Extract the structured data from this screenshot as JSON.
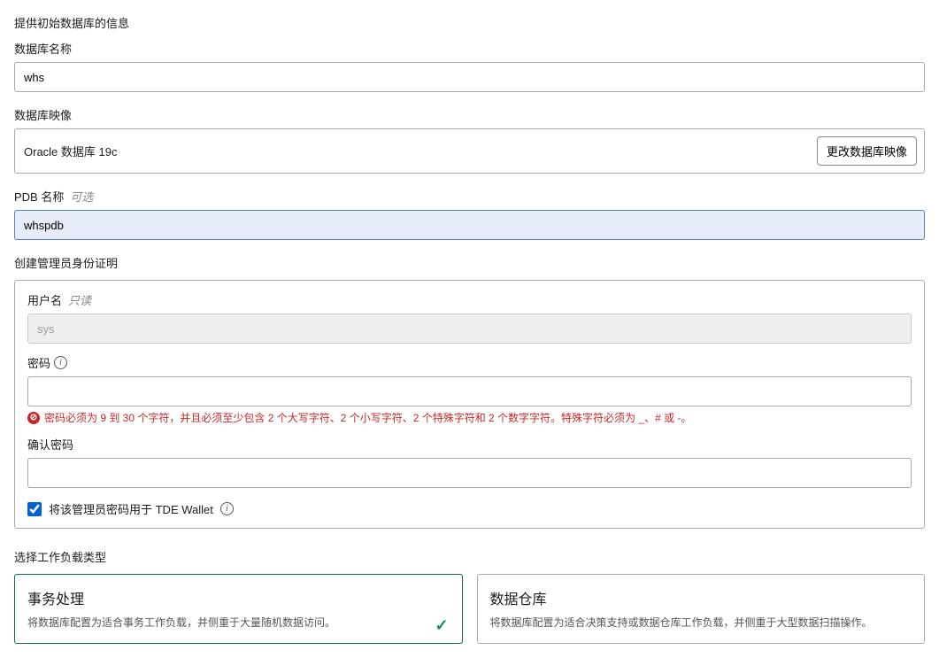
{
  "header": {
    "title": "提供初始数据库的信息"
  },
  "dbName": {
    "label": "数据库名称",
    "value": "whs"
  },
  "dbImage": {
    "label": "数据库映像",
    "value": "Oracle 数据库 19c",
    "changeBtn": "更改数据库映像"
  },
  "pdb": {
    "label": "PDB 名称",
    "optional": "可选",
    "value": "whspdb"
  },
  "admin": {
    "sectionLabel": "创建管理员身份证明",
    "username": {
      "label": "用户名",
      "readonly": "只读",
      "placeholder": "sys"
    },
    "password": {
      "label": "密码",
      "error": "密码必须为 9 到 30 个字符，并且必须至少包含 2 个大写字符、2 个小写字符、2 个特殊字符和 2 个数字字符。特殊字符必须为 _、# 或 -。"
    },
    "confirm": {
      "label": "确认密码"
    },
    "tde": {
      "label": "将该管理员密码用于 TDE Wallet",
      "checked": true
    }
  },
  "workload": {
    "sectionLabel": "选择工作负载类型",
    "options": [
      {
        "title": "事务处理",
        "desc": "将数据库配置为适合事务工作负载，并侧重于大量随机数据访问。",
        "selected": true
      },
      {
        "title": "数据仓库",
        "desc": "将数据库配置为适合决策支持或数据仓库工作负载，并侧重于大型数据扫描操作。",
        "selected": false
      }
    ]
  }
}
